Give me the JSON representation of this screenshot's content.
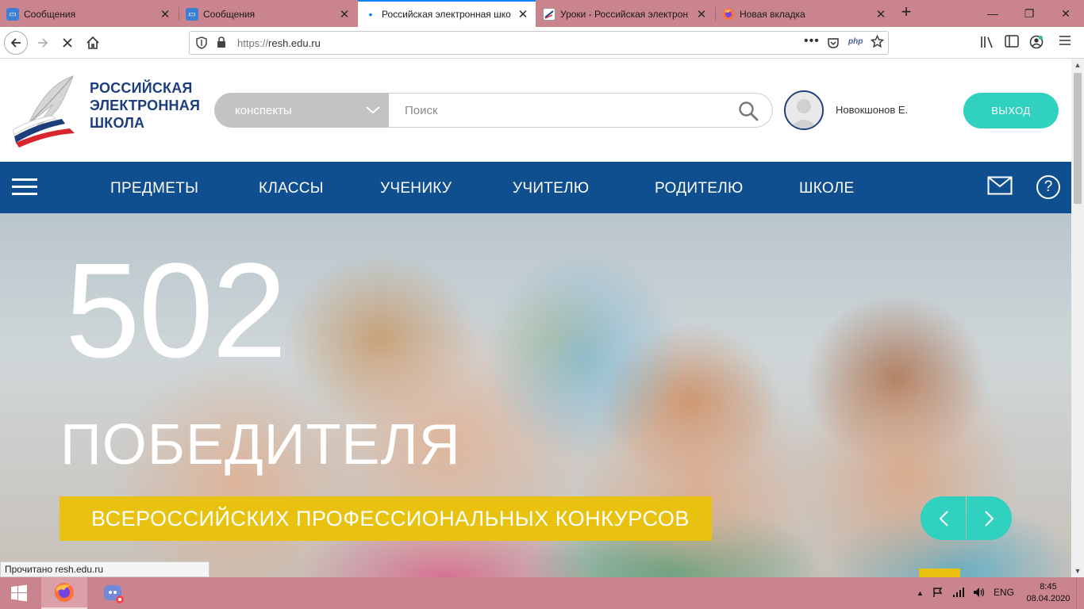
{
  "browser": {
    "tabs": [
      {
        "title": "Сообщения"
      },
      {
        "title": "Сообщения"
      },
      {
        "title": "Российская электронная шко"
      },
      {
        "title": "Уроки - Российская электрон"
      },
      {
        "title": "Новая вкладка"
      }
    ],
    "active_tab_index": 2,
    "url_protocol": "https://",
    "url_host": "resh.edu.ru",
    "page_action_label": "php"
  },
  "header": {
    "logo_line1": "РОССИЙСКАЯ",
    "logo_line2": "ЭЛЕКТРОННАЯ",
    "logo_line3": "ШКОЛА",
    "search_category": "конспекты",
    "search_placeholder": "Поиск",
    "username": "Новокшонов Е.",
    "logout_label": "ВЫХОД"
  },
  "menu": {
    "items": [
      "ПРЕДМЕТЫ",
      "КЛАССЫ",
      "УЧЕНИКУ",
      "УЧИТЕЛЮ",
      "РОДИТЕЛЮ",
      "ШКОЛЕ"
    ]
  },
  "hero": {
    "number": "502",
    "title": "ПОБЕДИТЕЛЯ",
    "subtitle": "ВСЕРОССИЙСКИХ ПРОФЕССИОНАЛЬНЫХ КОНКУРСОВ"
  },
  "status_text": "Прочитано resh.edu.ru",
  "taskbar": {
    "language": "ENG",
    "time": "8:45",
    "date": "08.04.2020"
  },
  "colors": {
    "brand_blue": "#0f4f8f",
    "teal": "#31d1c0",
    "yellow": "#e8c20f",
    "tabbar": "#c9848e"
  }
}
